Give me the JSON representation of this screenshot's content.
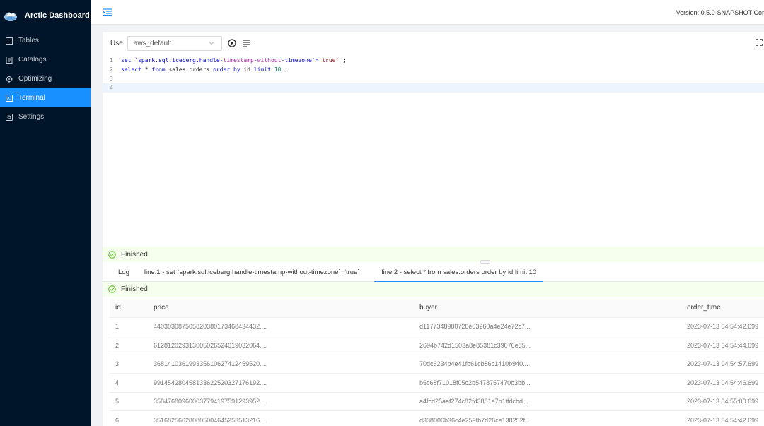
{
  "app": {
    "title": "Arctic Dashboard"
  },
  "sidebar": {
    "items": [
      {
        "label": "Tables",
        "icon": "table-icon"
      },
      {
        "label": "Catalogs",
        "icon": "catalog-icon"
      },
      {
        "label": "Optimizing",
        "icon": "optimizing-icon"
      },
      {
        "label": "Terminal",
        "icon": "terminal-icon",
        "active": true
      },
      {
        "label": "Settings",
        "icon": "settings-icon"
      }
    ]
  },
  "header": {
    "version": "Version: 0.5.0-SNAPSHOT  Cor"
  },
  "toolbar": {
    "use_label": "Use",
    "catalog_selected": "aws_default"
  },
  "editor": {
    "lines": [
      {
        "num": "1"
      },
      {
        "num": "2"
      },
      {
        "num": "3"
      },
      {
        "num": "4"
      }
    ],
    "line1": {
      "a": "set `spark.sql.iceberg.handle-",
      "b": "timestamp",
      "c": "-",
      "d": "without",
      "e": "-timezone`=",
      "f": "'true'",
      "g": " ;"
    },
    "line2": {
      "a": "select",
      "b": " * ",
      "c": "from",
      "d": " sales.orders ",
      "e": "order by",
      "f": " id ",
      "g": "limit",
      "h": " ",
      "i": "10",
      "j": " ;"
    }
  },
  "status": {
    "finished": "Finished"
  },
  "result_tabs": [
    "Log",
    "line:1 - set `spark.sql.iceberg.handle-timestamp-without-timezone`='true`",
    "line:2 - select * from sales.orders order by id limit 10"
  ],
  "result": {
    "status": "Finished",
    "columns": [
      "id",
      "price",
      "buyer",
      "order_time"
    ],
    "rows": [
      [
        "1",
        "440303087505820380173468434432....",
        "d1177348980728e03260a4e24e72c7...",
        "2023-07-13 04:54:42.699"
      ],
      [
        "2",
        "612812029313005026524019032064....",
        "2694b742d1503a8e85381c39076e85...",
        "2023-07-13 04:54:44.699"
      ],
      [
        "3",
        "368141036199335610627412459520....",
        "70dc6234b4e41fb61cb86c1410b940...",
        "2023-07-13 04:54:57.699"
      ],
      [
        "4",
        "991454280458133622520327176192....",
        "b5c68f71018f05c2b5478757470b3bb...",
        "2023-07-13 04:54:46.699"
      ],
      [
        "5",
        "358476809600037794197591293952....",
        "a4fcd25aaf274c82fd3881e7b1ffdcbd...",
        "2023-07-13 04:55:00.699"
      ],
      [
        "6",
        "351682566280805004645253513216....",
        "d338000b36c4e259fb7d26ce138252f...",
        "2023-07-13 04:54:42.699"
      ]
    ]
  },
  "colors": {
    "sidebar_bg": "#001529",
    "accent": "#1890ff",
    "success_bg": "#f6ffed",
    "success": "#52c41a"
  }
}
